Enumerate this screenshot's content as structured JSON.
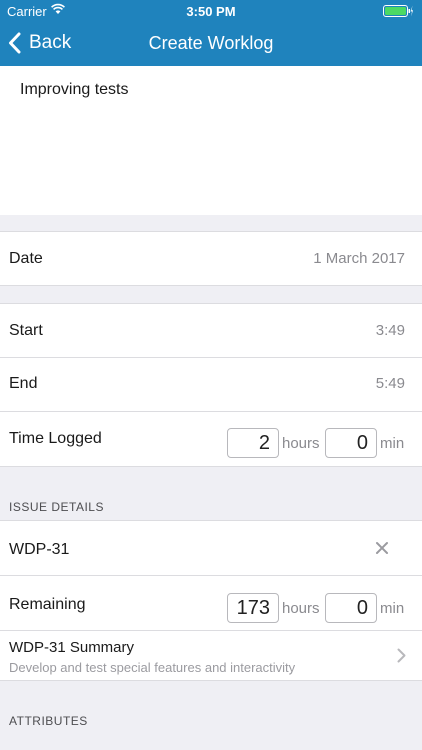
{
  "status_bar": {
    "carrier": "Carrier",
    "time": "3:50 PM"
  },
  "nav": {
    "back_label": "Back",
    "title": "Create Worklog"
  },
  "description": "Improving tests",
  "date": {
    "label": "Date",
    "value": "1 March 2017"
  },
  "start": {
    "label": "Start",
    "value": "3:49"
  },
  "end": {
    "label": "End",
    "value": "5:49"
  },
  "time_logged": {
    "label": "Time Logged",
    "hours": "2",
    "hours_unit": "hours",
    "minutes": "0",
    "minutes_unit": "min"
  },
  "issue_details": {
    "header": "ISSUE DETAILS",
    "issue_key": "WDP-31",
    "remaining_label": "Remaining",
    "remaining_hours": "173",
    "hours_unit": "hours",
    "remaining_minutes": "0",
    "minutes_unit": "min",
    "summary_title": "WDP-31 Summary",
    "summary_text": "Develop and test special features and interactivity"
  },
  "attributes": {
    "header": "ATTRIBUTES"
  },
  "colors": {
    "nav_bar": "#1f83bd",
    "battery": "#4cd964",
    "background": "#efeff4"
  }
}
